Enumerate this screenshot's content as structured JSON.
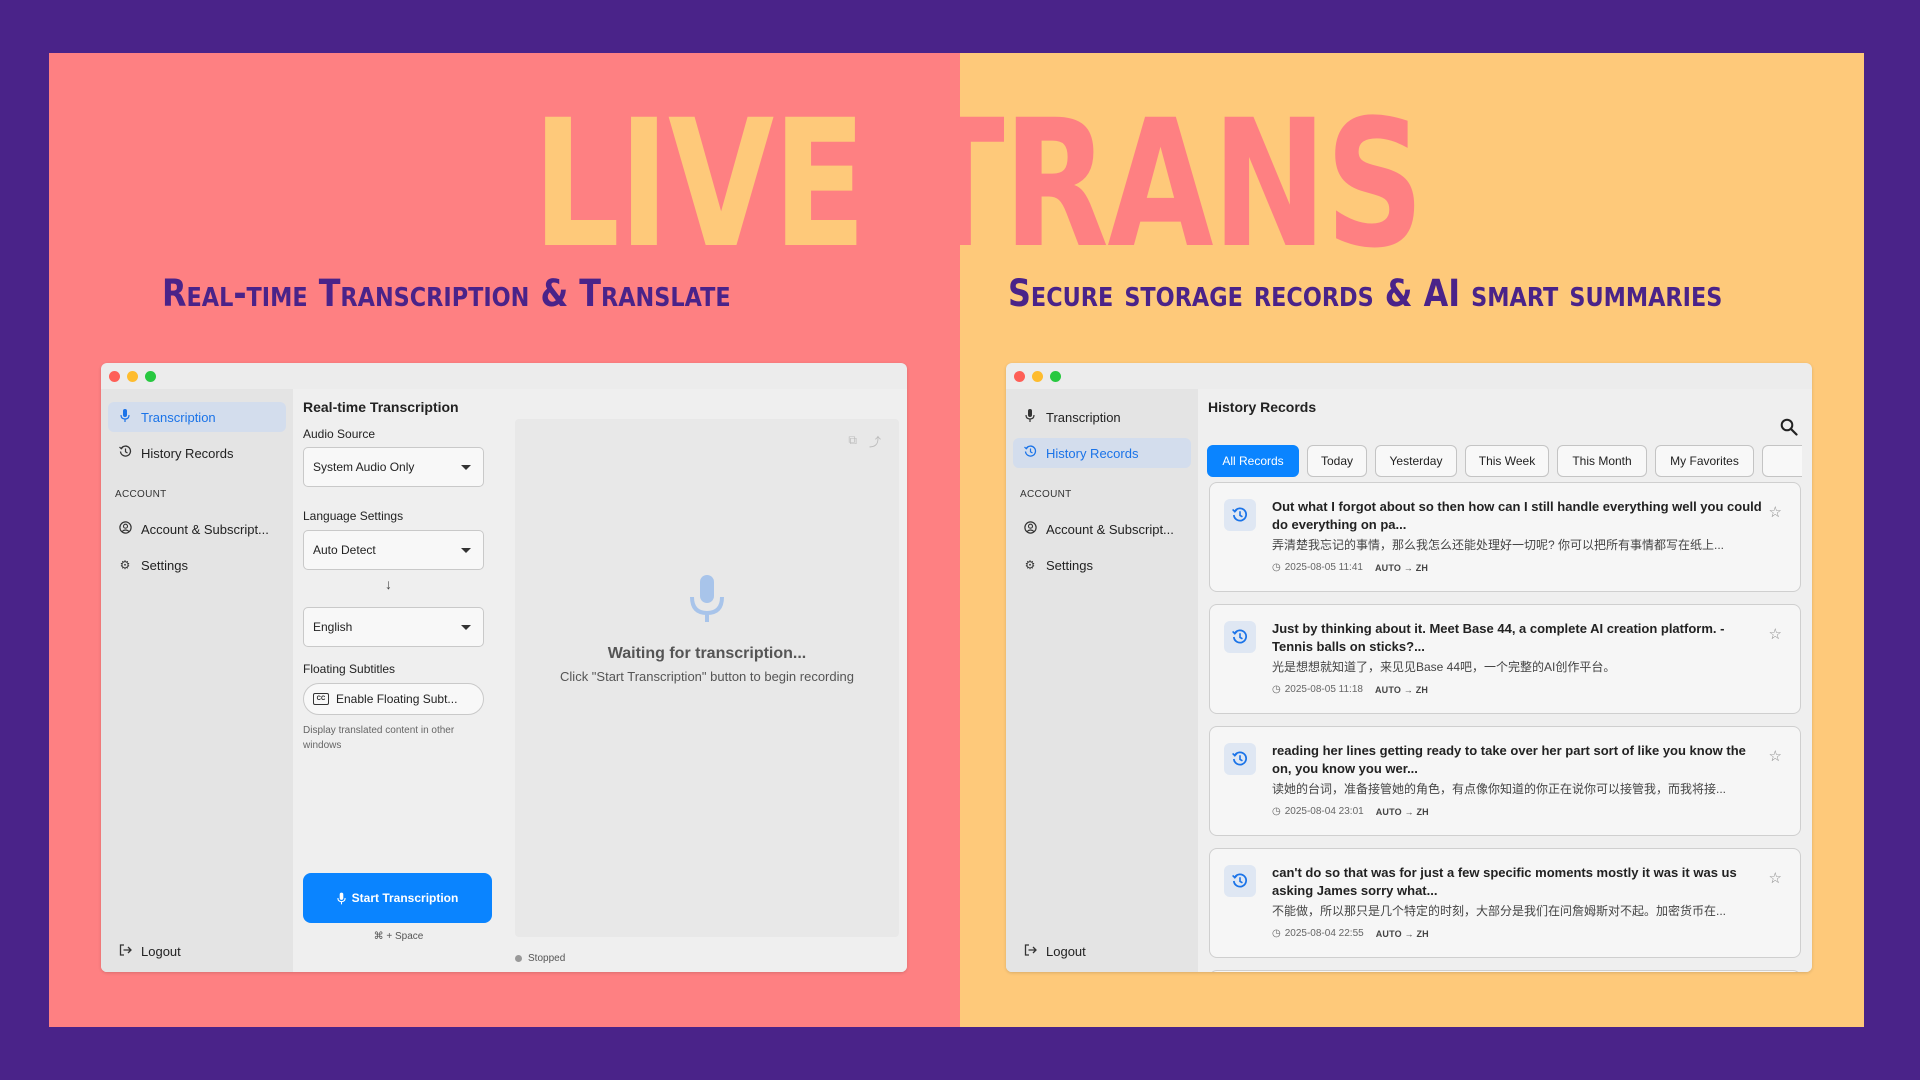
{
  "banner": {
    "title_part1": "LIVE",
    "title_part2": "TRANS",
    "subtitle_left": "Real-time Transcription & Translate",
    "subtitle_right": "Secure storage records & AI smart summaries"
  },
  "colors": {
    "background": "#4a2389",
    "left_panel": "#fe8082",
    "right_panel": "#fec97a",
    "accent": "#0a84ff"
  },
  "sidebar": {
    "items": [
      {
        "label": "Transcription",
        "icon": "microphone-icon"
      },
      {
        "label": "History Records",
        "icon": "history-icon"
      }
    ],
    "account_label": "ACCOUNT",
    "account_items": [
      {
        "label": "Account & Subscript...",
        "icon": "user-circle-icon"
      },
      {
        "label": "Settings",
        "icon": "gear-icon"
      }
    ],
    "logout_label": "Logout"
  },
  "transcription": {
    "title": "Real-time Transcription",
    "audio_source_label": "Audio Source",
    "audio_source_value": "System Audio Only",
    "language_label": "Language Settings",
    "source_language": "Auto Detect",
    "target_language": "English",
    "floating_label": "Floating Subtitles",
    "floating_button": "Enable Floating Subt...",
    "floating_hint": "Display translated content in other windows",
    "start_button": "Start Transcription",
    "shortcut": "⌘ + Space",
    "waiting_title": "Waiting for transcription...",
    "waiting_sub": "Click \"Start Transcription\" button to begin recording",
    "status": "Stopped"
  },
  "history": {
    "title": "History Records",
    "filters": [
      "All Records",
      "Today",
      "Yesterday",
      "This Week",
      "This Month",
      "My Favorites"
    ],
    "records": [
      {
        "title": "Out what I forgot about so then how can I still handle everything well you could do everything on pa...",
        "translation": "弄清楚我忘记的事情，那么我怎么还能处理好一切呢? 你可以把所有事情都写在纸上...",
        "time": "2025-08-05 11:41",
        "lang": "AUTO → ZH"
      },
      {
        "title": "Just by thinking about it. Meet Base 44, a complete AI creation platform. - Tennis balls on sticks?...",
        "translation": "光是想想就知道了，来见见Base 44吧，一个完整的AI创作平台。",
        "time": "2025-08-05 11:18",
        "lang": "AUTO → ZH"
      },
      {
        "title": "reading her lines getting ready to take over her part sort of like you know the on, you know you wer...",
        "translation": "读她的台词，准备接管她的角色，有点像你知道的你正在说你可以接管我，而我将接...",
        "time": "2025-08-04 23:01",
        "lang": "AUTO → ZH"
      },
      {
        "title": "can't do so that was for just a few specific moments mostly it was it was us asking James sorry what...",
        "translation": "不能做，所以那只是几个特定的时刻，大部分是我们在问詹姆斯对不起。加密货币在...",
        "time": "2025-08-04 22:55",
        "lang": "AUTO → ZH"
      }
    ]
  }
}
